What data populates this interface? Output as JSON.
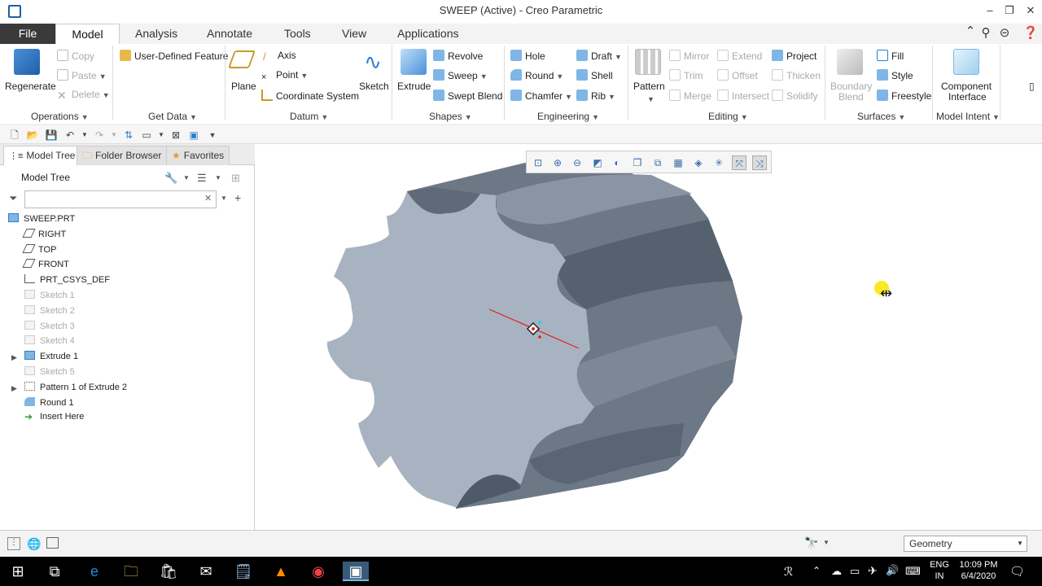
{
  "window": {
    "title": "SWEEP (Active) - Creo Parametric"
  },
  "menu_tabs": [
    "File",
    "Model",
    "Analysis",
    "Annotate",
    "Tools",
    "View",
    "Applications"
  ],
  "ribbon": {
    "operations": {
      "regenerate": "Regenerate",
      "copy": "Copy",
      "paste": "Paste",
      "delete": "Delete",
      "label": "Operations"
    },
    "get_data": {
      "udf": "User-Defined Feature",
      "label": "Get Data"
    },
    "datum": {
      "plane": "Plane",
      "axis": "Axis",
      "point": "Point",
      "csys": "Coordinate System",
      "sketch": "Sketch",
      "label": "Datum"
    },
    "shapes": {
      "extrude": "Extrude",
      "revolve": "Revolve",
      "sweep": "Sweep",
      "swept_blend": "Swept Blend",
      "label": "Shapes"
    },
    "engineering": {
      "hole": "Hole",
      "round": "Round",
      "chamfer": "Chamfer",
      "draft": "Draft",
      "shell": "Shell",
      "rib": "Rib",
      "label": "Engineering"
    },
    "editing": {
      "pattern": "Pattern",
      "mirror": "Mirror",
      "trim": "Trim",
      "merge": "Merge",
      "extend": "Extend",
      "offset": "Offset",
      "intersect": "Intersect",
      "project": "Project",
      "thicken": "Thicken",
      "solidify": "Solidify",
      "label": "Editing"
    },
    "surfaces": {
      "boundary_blend_1": "Boundary",
      "boundary_blend_2": "Blend",
      "fill": "Fill",
      "style": "Style",
      "freestyle": "Freestyle",
      "label": "Surfaces"
    },
    "model_intent": {
      "component_1": "Component",
      "component_2": "Interface",
      "label": "Model Intent"
    }
  },
  "left_panel": {
    "tabs": [
      "Model Tree",
      "Folder Browser",
      "Favorites"
    ],
    "header": "Model Tree",
    "filter_value": "",
    "tree": [
      {
        "label": "SWEEP.PRT",
        "icon": "part-icon",
        "dim": false,
        "expandable": false,
        "indent": 0
      },
      {
        "label": "RIGHT",
        "icon": "datum-plane-icon",
        "dim": false,
        "expandable": false,
        "indent": 1
      },
      {
        "label": "TOP",
        "icon": "datum-plane-icon",
        "dim": false,
        "expandable": false,
        "indent": 1
      },
      {
        "label": "FRONT",
        "icon": "datum-plane-icon",
        "dim": false,
        "expandable": false,
        "indent": 1
      },
      {
        "label": "PRT_CSYS_DEF",
        "icon": "csys-icon",
        "dim": false,
        "expandable": false,
        "indent": 1
      },
      {
        "label": "Sketch 1",
        "icon": "sketch-icon",
        "dim": true,
        "expandable": false,
        "indent": 1
      },
      {
        "label": "Sketch 2",
        "icon": "sketch-icon",
        "dim": true,
        "expandable": false,
        "indent": 1
      },
      {
        "label": "Sketch 3",
        "icon": "sketch-icon",
        "dim": true,
        "expandable": false,
        "indent": 1
      },
      {
        "label": "Sketch 4",
        "icon": "sketch-icon",
        "dim": true,
        "expandable": false,
        "indent": 1
      },
      {
        "label": "Extrude 1",
        "icon": "extrude-icon",
        "dim": false,
        "expandable": true,
        "indent": 1
      },
      {
        "label": "Sketch 5",
        "icon": "sketch-icon",
        "dim": true,
        "expandable": false,
        "indent": 1
      },
      {
        "label": "Pattern 1 of Extrude 2",
        "icon": "pattern-icon",
        "dim": false,
        "expandable": true,
        "indent": 1
      },
      {
        "label": "Round 1",
        "icon": "round-icon",
        "dim": false,
        "expandable": false,
        "indent": 1
      },
      {
        "label": "Insert Here",
        "icon": "insert-arrow-icon",
        "dim": false,
        "expandable": false,
        "indent": 1
      }
    ]
  },
  "status_bar": {
    "filter_select": "Geometry"
  },
  "taskbar": {
    "lang_1": "ENG",
    "lang_2": "IN",
    "time": "10:09 PM",
    "date": "6/4/2020"
  },
  "colors": {
    "accent": "#1e5fa8",
    "gear_face": "#a8b3c1",
    "gear_side": "#6d7886",
    "file_tab": "#3a3a3a"
  }
}
